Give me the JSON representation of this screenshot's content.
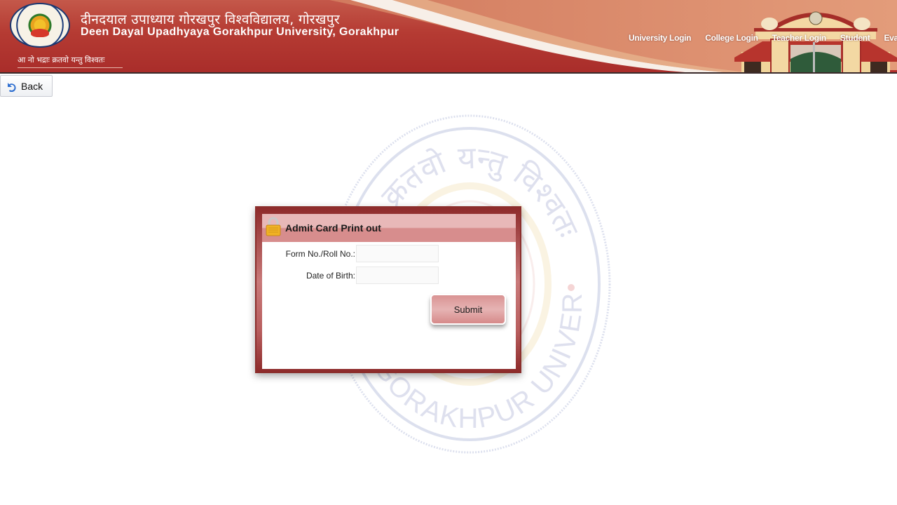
{
  "header": {
    "title_hindi": "दीनदयाल उपाध्याय गोरखपुर विश्वविद्यालय, गोरखपुर",
    "title_english": "Deen Dayal Upadhyaya Gorakhpur University, Gorakhpur",
    "motto": "आ नो भद्राः क्रतवो यन्तु विश्वतः",
    "logo_icon": "university-seal-icon",
    "gate_image": "university-gate-image",
    "nav": [
      {
        "label": "University Login"
      },
      {
        "label": "College Login"
      },
      {
        "label": "Teacher Login"
      },
      {
        "label": "Student"
      },
      {
        "label": "Evaluat"
      }
    ]
  },
  "toolbar": {
    "back_label": "Back",
    "back_icon": "undo-arrow-icon"
  },
  "watermark": {
    "top_text": "भद्रा क्रतवो यन्तु विश्वतः",
    "bottom_text": "GORAKHPUR UNIVERSITY"
  },
  "dialog": {
    "title": "Admit Card Print out",
    "icon": "lock-icon",
    "fields": [
      {
        "label": "Form No./Roll No.:",
        "value": "",
        "placeholder": ""
      },
      {
        "label": "Date of Birth:",
        "value": "",
        "placeholder": ""
      }
    ],
    "submit_label": "Submit"
  },
  "colors": {
    "header_red": "#b53b33",
    "dialog_border": "#8b2e2c",
    "dialog_header": "#e8b8b8",
    "button_pink": "#d99393"
  }
}
